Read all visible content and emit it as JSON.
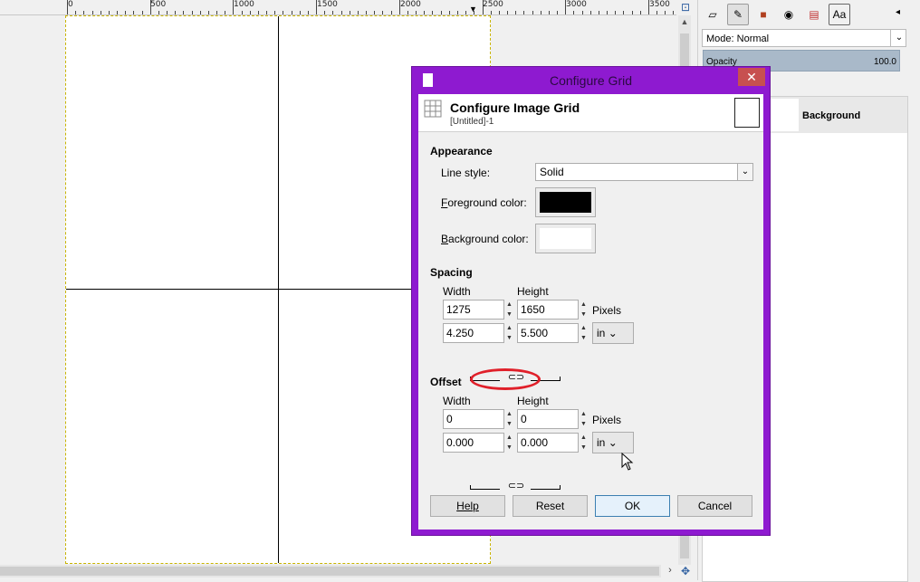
{
  "ruler": {
    "labels": [
      "0",
      "500",
      "1000",
      "1500",
      "2000",
      "2500",
      "3000",
      "3500"
    ]
  },
  "dock": {
    "tabs": [
      "layers-tab-icon",
      "paths-tab-icon",
      "channels-tab-icon",
      "brushes-tab-icon",
      "palette-tab-icon",
      "fonts-tab-icon"
    ],
    "fonts_tab_label": "Aa",
    "mode_label": "Mode: Normal",
    "opacity_label": "Opacity",
    "opacity_value": "100.0",
    "layer_name": "Background"
  },
  "dialog": {
    "window_title": "Configure Grid",
    "header_title": "Configure Image Grid",
    "header_subtitle": "[Untitled]-1",
    "appearance": {
      "title": "Appearance",
      "line_style_label": "Line style:",
      "line_style_value": "Solid",
      "foreground_label_accel": "F",
      "foreground_label_rest": "oreground color:",
      "foreground_color": "#000000",
      "background_label_accel": "B",
      "background_label_rest": "ackground color:",
      "background_color": "#ffffff"
    },
    "spacing": {
      "title": "Spacing",
      "width_label": "Width",
      "height_label": "Height",
      "width_px": "1275",
      "height_px": "1650",
      "px_unit": "Pixels",
      "width_in": "4.250",
      "height_in": "5.500",
      "unit": "in"
    },
    "offset": {
      "title": "Offset",
      "width_label": "Width",
      "height_label": "Height",
      "width_px": "0",
      "height_px": "0",
      "px_unit": "Pixels",
      "width_in": "0.000",
      "height_in": "0.000",
      "unit": "in"
    },
    "buttons": {
      "help": "Help",
      "reset": "Reset",
      "ok": "OK",
      "cancel": "Cancel"
    }
  }
}
